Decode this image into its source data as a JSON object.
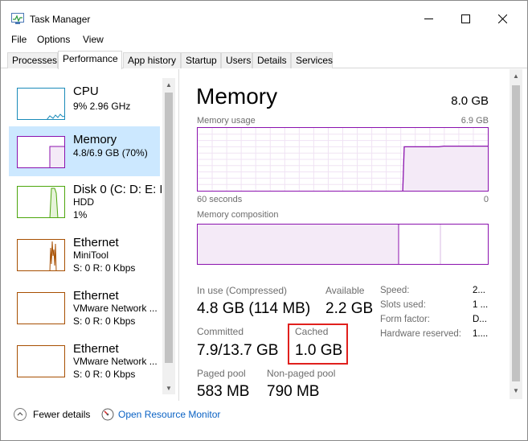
{
  "window": {
    "title": "Task Manager"
  },
  "menu": {
    "file": "File",
    "options": "Options",
    "view": "View"
  },
  "tabs": [
    "Processes",
    "Performance",
    "App history",
    "Startup",
    "Users",
    "Details",
    "Services"
  ],
  "active_tab": "Performance",
  "sidebar": {
    "items": [
      {
        "name": "CPU",
        "line1": "9%  2.96 GHz",
        "line2": "",
        "color": "#1a8bb9"
      },
      {
        "name": "Memory",
        "line1": "4.8/6.9 GB (70%)",
        "line2": "",
        "color": "#8b12ae"
      },
      {
        "name": "Disk 0 (C: D: E: F",
        "line1": "HDD",
        "line2": "1%",
        "color": "#4da60c"
      },
      {
        "name": "Ethernet",
        "line1": "MiniTool",
        "line2": "S: 0 R: 0 Kbps",
        "color": "#a74f01"
      },
      {
        "name": "Ethernet",
        "line1": "VMware Network ...",
        "line2": "S: 0 R: 0 Kbps",
        "color": "#a74f01"
      },
      {
        "name": "Ethernet",
        "line1": "VMware Network ...",
        "line2": "S: 0 R: 0 Kbps",
        "color": "#a74f01"
      }
    ]
  },
  "memory": {
    "title": "Memory",
    "total": "8.0 GB",
    "usage_label": "Memory usage",
    "usage_max": "6.9 GB",
    "time_label": "60 seconds",
    "time_end": "0",
    "composition_label": "Memory composition",
    "usage_history_fraction": [
      0,
      0,
      0,
      0,
      0,
      0,
      0,
      0,
      0,
      0,
      0,
      0,
      0,
      0,
      0,
      0,
      0,
      0,
      0,
      0,
      0,
      0,
      0,
      0,
      0,
      0,
      0,
      0,
      0,
      0,
      0,
      0,
      0,
      0,
      0,
      0,
      0,
      0,
      0,
      0,
      0,
      0,
      0.7,
      0.7,
      0.7,
      0.7,
      0.7,
      0.7,
      0.7,
      0.7,
      0.71,
      0.71,
      0.71,
      0.71,
      0.71,
      0.71,
      0.71,
      0.71,
      0.71,
      0.71
    ],
    "stats": {
      "in_use_label": "In use (Compressed)",
      "in_use_value": "4.8 GB (114 MB)",
      "available_label": "Available",
      "available_value": "2.2 GB",
      "committed_label": "Committed",
      "committed_value": "7.9/13.7 GB",
      "cached_label": "Cached",
      "cached_value": "1.0 GB",
      "paged_label": "Paged pool",
      "paged_value": "583 MB",
      "nonpaged_label": "Non-paged pool",
      "nonpaged_value": "790 MB"
    },
    "specs": [
      {
        "label": "Speed:",
        "value": "2..."
      },
      {
        "label": "Slots used:",
        "value": "1 ..."
      },
      {
        "label": "Form factor:",
        "value": "D..."
      },
      {
        "label": "Hardware reserved:",
        "value": "1...."
      }
    ]
  },
  "footer": {
    "fewer": "Fewer details",
    "resource_monitor": "Open Resource Monitor"
  },
  "colors": {
    "memory_accent": "#8b12ae",
    "selected_bg": "#cce8ff",
    "link": "#0a62c4",
    "highlight": "#e0201d"
  }
}
